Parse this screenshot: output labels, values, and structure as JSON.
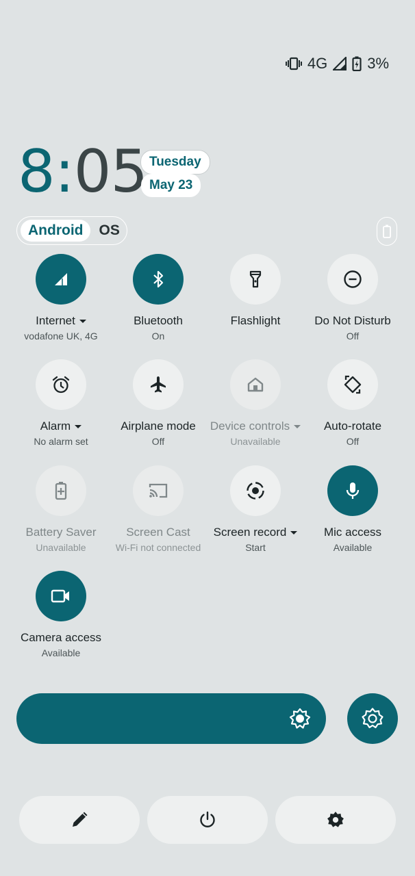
{
  "status_bar": {
    "network": "4G",
    "battery": "3%"
  },
  "clock": {
    "hour": "8",
    "colon": ":",
    "minutes": "05"
  },
  "date": {
    "day": "Tuesday",
    "date": "May 23"
  },
  "os_toggle": {
    "first": "Android",
    "second": "OS"
  },
  "tiles": [
    {
      "label": "Internet",
      "sub": "vodafone UK, 4G",
      "icon": "signal-icon",
      "state": "on",
      "dropdown": true
    },
    {
      "label": "Bluetooth",
      "sub": "On",
      "icon": "bluetooth-icon",
      "state": "on"
    },
    {
      "label": "Flashlight",
      "sub": "",
      "icon": "flashlight-icon",
      "state": "off"
    },
    {
      "label": "Do Not Disturb",
      "sub": "Off",
      "icon": "do-not-disturb-icon",
      "state": "off"
    },
    {
      "label": "Alarm",
      "sub": "No alarm set",
      "icon": "alarm-icon",
      "state": "off",
      "dropdown": true
    },
    {
      "label": "Airplane mode",
      "sub": "Off",
      "icon": "airplane-icon",
      "state": "off"
    },
    {
      "label": "Device controls",
      "sub": "Unavailable",
      "icon": "home-icon",
      "state": "unavailable",
      "dropdown": true
    },
    {
      "label": "Auto-rotate",
      "sub": "Off",
      "icon": "rotate-icon",
      "state": "off"
    },
    {
      "label": "Battery Saver",
      "sub": "Unavailable",
      "icon": "battery-saver-icon",
      "state": "unavailable"
    },
    {
      "label": "Screen Cast",
      "sub": "Wi-Fi not connected",
      "icon": "cast-icon",
      "state": "unavailable"
    },
    {
      "label": "Screen record",
      "sub": "Start",
      "icon": "screen-record-icon",
      "state": "off",
      "dropdown": true
    },
    {
      "label": "Mic access",
      "sub": "Available",
      "icon": "mic-icon",
      "state": "on"
    },
    {
      "label": "Camera access",
      "sub": "Available",
      "icon": "camera-icon",
      "state": "on"
    }
  ],
  "brightness": {
    "icon": "brightness-icon"
  },
  "bottom_buttons": [
    {
      "icon": "edit-icon"
    },
    {
      "icon": "power-icon"
    },
    {
      "icon": "settings-icon"
    }
  ],
  "colors": {
    "accent": "#0b6572",
    "background": "#dfe3e4",
    "tile_off": "#eef0f0"
  }
}
